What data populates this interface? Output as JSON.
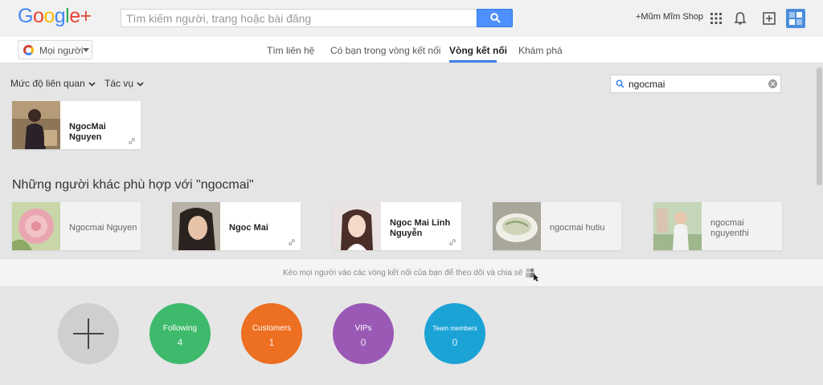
{
  "header": {
    "logo_text": "Google+",
    "search_placeholder": "Tìm kiếm người, trang hoặc bài đăng",
    "shop_link": "+Mũm Mĩm Shop",
    "icons": [
      "apps-icon",
      "bell-icon",
      "share-box-icon",
      "avatar"
    ]
  },
  "nav": {
    "people_button": "Mọi người",
    "tabs": [
      {
        "label": "Tìm liên hệ"
      },
      {
        "label": "Có bạn trong vòng kết nối"
      },
      {
        "label": "Vòng kết nối",
        "active": true
      },
      {
        "label": "Khám phá"
      }
    ]
  },
  "toolbar": {
    "sort_label": "Mức độ liên quan",
    "actions_label": "Tác vụ",
    "circle_search_value": "ngocmai"
  },
  "result": {
    "name": "NgocMai Nguyen"
  },
  "others": {
    "title": "Những người khác phù hợp với \"ngocmai\"",
    "people": [
      {
        "name": "Ngocmai Nguyen"
      },
      {
        "name": "Ngoc Mai"
      },
      {
        "name": "Ngoc Mai Linh Nguyễn"
      },
      {
        "name": "ngocmai hutiu"
      },
      {
        "name": "ngocmai nguyenthi"
      }
    ]
  },
  "drag_hint": "Kéo mọi người vào các vòng kết nối của bạn để theo dõi và chia sẻ",
  "circles": [
    {
      "label": "Following",
      "count": "4",
      "color": "#3dba6b"
    },
    {
      "label": "Customers",
      "count": "1",
      "color": "#ed6f21"
    },
    {
      "label": "VIPs",
      "count": "0",
      "color": "#9b59b6"
    },
    {
      "label": "Team members",
      "count": "0",
      "color": "#1ba3d6"
    }
  ],
  "colors": {
    "accent": "#427fed",
    "search_button": "#4d90fe"
  }
}
